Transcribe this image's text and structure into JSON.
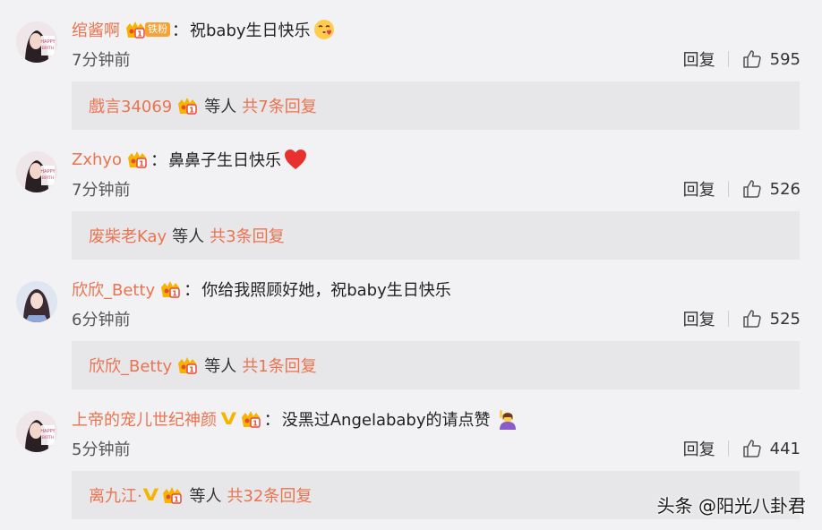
{
  "comments": [
    {
      "username": "绾酱啊",
      "fan_tag": "铁粉",
      "colon": "：",
      "text": "祝baby生日快乐",
      "time": "7分钟前",
      "reply_label": "回复",
      "likes": "595",
      "reply_users": "戲言34069",
      "reply_mid": "等人",
      "reply_total": "共7条回复"
    },
    {
      "username": "Zxhyo",
      "colon": "：",
      "text": "鼻鼻子生日快乐",
      "time": "7分钟前",
      "reply_label": "回复",
      "likes": "526",
      "reply_users": "废柴老Kay",
      "reply_mid": "等人",
      "reply_total": "共3条回复"
    },
    {
      "username": "欣欣_Betty",
      "colon": "：",
      "text": "你给我照顾好她，祝baby生日快乐",
      "time": "6分钟前",
      "reply_label": "回复",
      "likes": "525",
      "reply_users": "欣欣_Betty",
      "reply_mid": "等人",
      "reply_total": "共1条回复"
    },
    {
      "username": "上帝的宠儿世纪神颜",
      "colon": "：",
      "text": "没黑过Angelababy的请点赞",
      "time": "5分钟前",
      "reply_label": "回复",
      "likes": "441",
      "reply_users": "离九江·",
      "reply_mid": "等人",
      "reply_total": "共32条回复"
    }
  ],
  "watermark": "头条 @阳光八卦君",
  "colors": {
    "username": "#eb7350",
    "background": "#f2f2f4",
    "reply_box": "#e7e7ea",
    "vip_badge": "#f6b400"
  }
}
